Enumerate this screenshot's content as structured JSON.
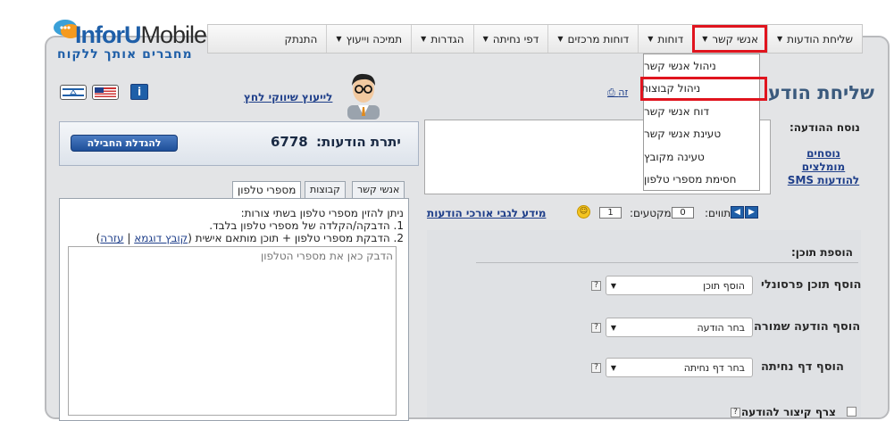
{
  "logo": {
    "brand_part1": "InforU",
    "brand_part2": "Mobile",
    "tagline": "מחברים אותך ללקוח"
  },
  "menu": {
    "items": [
      {
        "label": "שליחת הודעות"
      },
      {
        "label": "אנשי קשר"
      },
      {
        "label": "דוחות"
      },
      {
        "label": "דוחות מרכזים"
      },
      {
        "label": "דפי נחיתה"
      },
      {
        "label": "הגדרות"
      },
      {
        "label": "תמיכה וייעוץ"
      },
      {
        "label": "התנתק"
      }
    ],
    "dropdown": [
      "ניהול אנשי קשר",
      "ניהול קבוצות",
      "דוח אנשי קשר",
      "טעינת אנשי קשר",
      "טעינה מקובץ",
      "חסימת מספרי טלפון"
    ]
  },
  "header": {
    "info_label": "i",
    "advisor_link": "לייעוץ שיווקי לחץ",
    "page_title": "שליחת הודע",
    "help_fragment": "זה"
  },
  "balance": {
    "label": "יתרת הודעות:",
    "value": "6778",
    "increase_button": "להגדלת החבילה"
  },
  "tabs": {
    "contacts": "אנשי קשר",
    "groups": "קבוצות",
    "phones": "מספרי טלפון"
  },
  "phones_panel": {
    "line1": "ניתן להזין מספרי טלפון בשתי צורות:",
    "line2": "1. הדבקה/הקלדה של מספרי טלפון בלבד.",
    "line3_text": "2. הדבקת מספרי טלפון + תוכן מותאם אישית (",
    "sample_link": "קובץ דוגמא",
    "separator": " | ",
    "help_link": "עזרה",
    "line3_close": ")",
    "textarea_placeholder": "הדבק כאן את מספרי הטלפון"
  },
  "message": {
    "label": "נוסח ההודעה:",
    "templates_link": "נוסחים מומלצים להודעות SMS",
    "chars_label": "תווים:",
    "chars_value": "0",
    "segments_label": "מקטעים:",
    "segments_value": "1",
    "long_msg_link": "מידע לגבי אורכי הודעות"
  },
  "content": {
    "title": "הוספת תוכן:",
    "rows": [
      {
        "label": "הוסף תוכן פרסונלי",
        "value": "הוסף תוכן"
      },
      {
        "label": "הוסף הודעה שמורה",
        "value": "בחר הודעה"
      },
      {
        "label": "הוסף דף נחיתה",
        "value": "בחר דף נחיתה"
      }
    ],
    "cut_label": "צרף קיצור להודעה",
    "qmark": "?"
  },
  "colors": {
    "brand_blue": "#1f5fa8",
    "highlight_red": "#e0141e",
    "panel_gray": "#e3e4e6"
  }
}
